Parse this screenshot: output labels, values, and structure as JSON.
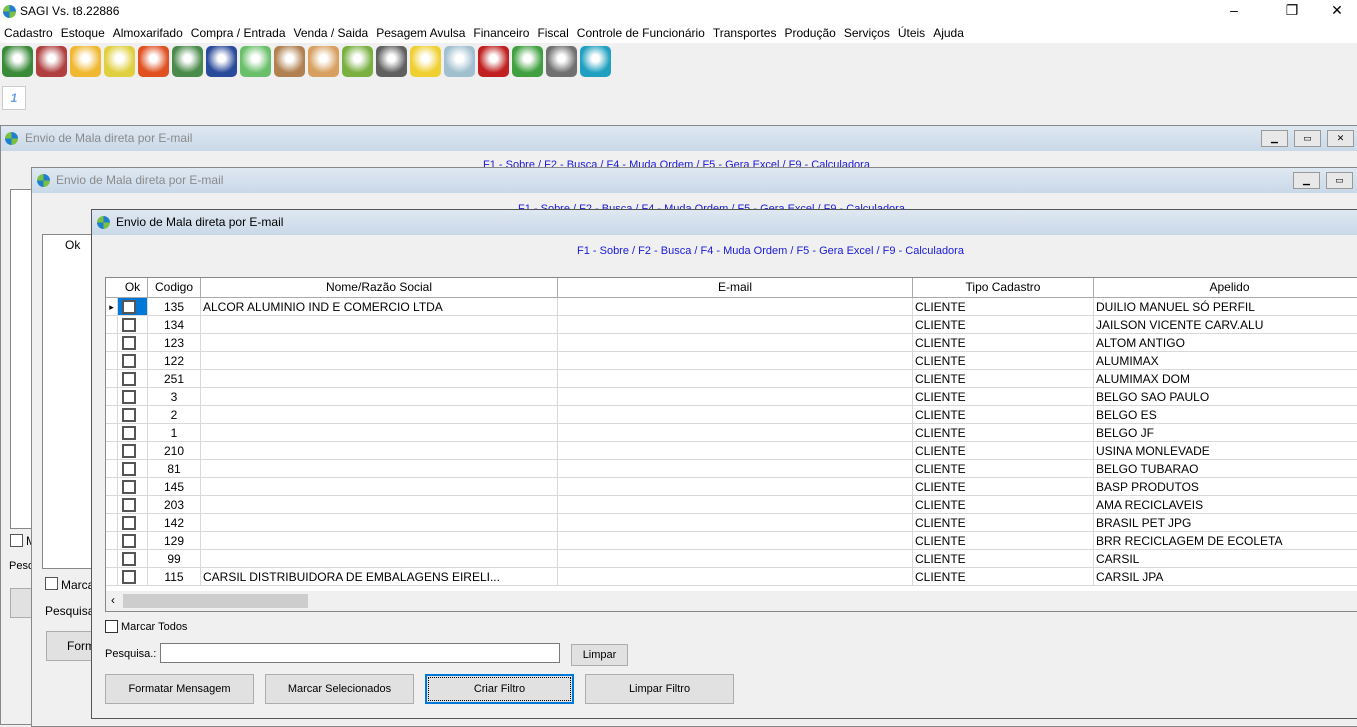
{
  "app": {
    "title": "SAGI Vs. t8.22886"
  },
  "menu": [
    "Cadastro",
    "Estoque",
    "Almoxarifado",
    "Compra / Entrada",
    "Venda / Saida",
    "Pesagem Avulsa",
    "Financeiro",
    "Fiscal",
    "Controle de Funcionário",
    "Transportes",
    "Produção",
    "Serviços",
    "Úteis",
    "Ajuda"
  ],
  "toolbar_icons": [
    "client-icon",
    "user-icon",
    "box-icon",
    "store-icon",
    "truck-icon",
    "trash-icon",
    "truck-green-icon",
    "money-icon",
    "clipboard-icon",
    "person-icon",
    "add-document-icon",
    "gear-icon",
    "globe-icon",
    "documents-icon",
    "usb-icon",
    "chart-icon",
    "calculator-icon",
    "exit-icon"
  ],
  "tab_label": "1",
  "window": {
    "title": "Envio de Mala direta por E-mail",
    "shortcuts": "F1 - Sobre  / F2 - Busca  / F4 - Muda Ordem  / F5 - Gera Excel  / F9 - Calculadora"
  },
  "grid": {
    "columns": [
      "Ok",
      "Codigo",
      "Nome/Razão Social",
      "E-mail",
      "Tipo Cadastro",
      "Apelido"
    ],
    "rows": [
      {
        "codigo": "135",
        "nome": "ALCOR ALUMINIO IND E COMERCIO LTDA",
        "tipo": "CLIENTE",
        "apelido": "DUILIO MANUEL SÓ PERFIL"
      },
      {
        "codigo": "134",
        "nome": "",
        "tipo": "CLIENTE",
        "apelido": "JAILSON VICENTE CARV.ALU"
      },
      {
        "codigo": "123",
        "nome": "",
        "tipo": "CLIENTE",
        "apelido": "ALTOM ANTIGO"
      },
      {
        "codigo": "122",
        "nome": "",
        "tipo": "CLIENTE",
        "apelido": "ALUMIMAX"
      },
      {
        "codigo": "251",
        "nome": "",
        "tipo": "CLIENTE",
        "apelido": "ALUMIMAX DOM"
      },
      {
        "codigo": "3",
        "nome": "",
        "tipo": "CLIENTE",
        "apelido": "BELGO SAO PAULO"
      },
      {
        "codigo": "2",
        "nome": "",
        "tipo": "CLIENTE",
        "apelido": "BELGO ES"
      },
      {
        "codigo": "1",
        "nome": "",
        "tipo": "CLIENTE",
        "apelido": "BELGO JF"
      },
      {
        "codigo": "210",
        "nome": "",
        "tipo": "CLIENTE",
        "apelido": "USINA MONLEVADE"
      },
      {
        "codigo": "81",
        "nome": "",
        "tipo": "CLIENTE",
        "apelido": "BELGO TUBARAO"
      },
      {
        "codigo": "145",
        "nome": "",
        "tipo": "CLIENTE",
        "apelido": "BASP PRODUTOS"
      },
      {
        "codigo": "203",
        "nome": "",
        "tipo": "CLIENTE",
        "apelido": "AMA RECICLAVEIS"
      },
      {
        "codigo": "142",
        "nome": "",
        "tipo": "CLIENTE",
        "apelido": "BRASIL PET JPG"
      },
      {
        "codigo": "129",
        "nome": "",
        "tipo": "CLIENTE",
        "apelido": "BRR RECICLAGEM DE ECOLETA"
      },
      {
        "codigo": "99",
        "nome": "",
        "tipo": "CLIENTE",
        "apelido": "CARSIL"
      },
      {
        "codigo": "115",
        "nome": "CARSIL DISTRIBUIDORA DE EMBALAGENS EIRELI...",
        "tipo": "CLIENTE",
        "apelido": "CARSIL JPA"
      }
    ]
  },
  "form": {
    "marcar_todos": "Marcar Todos",
    "pesquisa_label": "Pesquisa.:",
    "pesquisa_value": "",
    "limpar": "Limpar",
    "formatar": "Formatar Mensagem",
    "marcar_sel": "Marcar Selecionados",
    "criar_filtro": "Criar Filtro",
    "limpar_filtro": "Limpar Filtro"
  },
  "back": {
    "marcar": "Marca",
    "pesquisa": "Pesquisa.",
    "formatar": "Form",
    "m": "M",
    "pesq": "Pesq"
  }
}
